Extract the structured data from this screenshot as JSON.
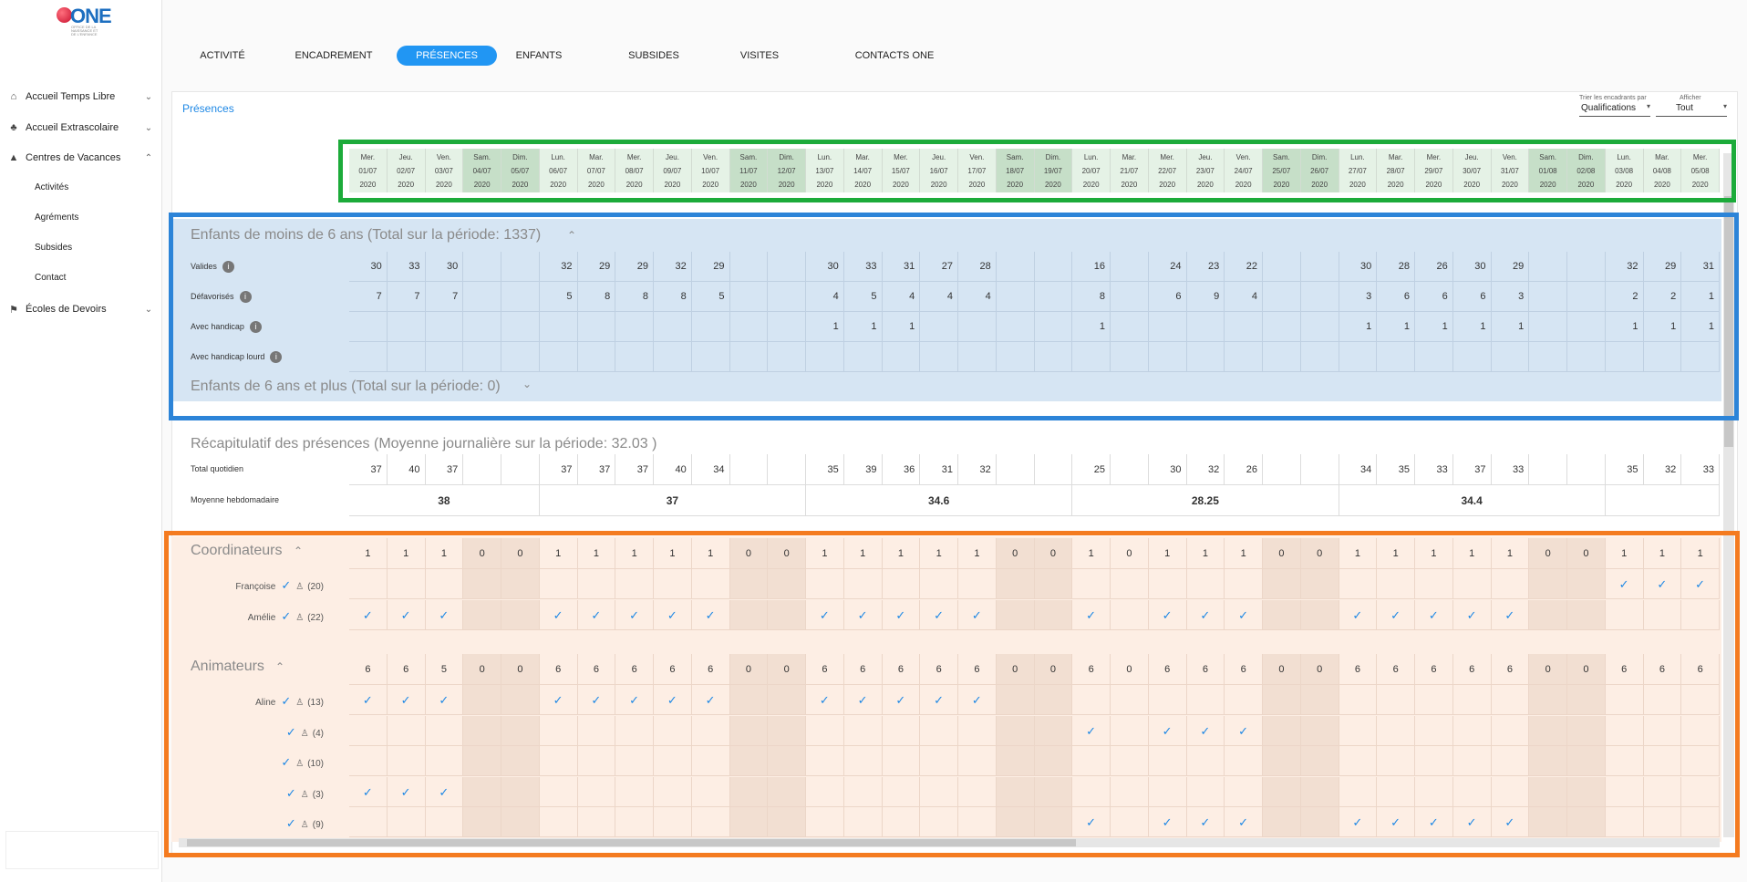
{
  "app": {
    "logo_text": "ONE",
    "logo_tagline": "OFFICE DE LA NAISSANCE ET DE L'ENFANCE"
  },
  "sidebar": {
    "items": [
      {
        "label": "Accueil Temps Libre",
        "icon": "house-icon"
      },
      {
        "label": "Accueil Extrascolaire",
        "icon": "tree-icon"
      },
      {
        "label": "Centres de Vacances",
        "icon": "tent-icon"
      },
      {
        "label": "Écoles de Devoirs",
        "icon": "school-icon"
      }
    ],
    "subitems": [
      "Activités",
      "Agréments",
      "Subsides",
      "Contact"
    ]
  },
  "tabs": [
    "ACTIVITÉ",
    "ENCADREMENT",
    "PRÉSENCES",
    "ENFANTS",
    "SUBSIDES",
    "VISITES",
    "CONTACTS ONE"
  ],
  "active_tab": "PRÉSENCES",
  "card": {
    "title": "Présences",
    "sort_label": "Trier les encadrants par",
    "sort_value": "Qualifications",
    "show_label": "Afficher",
    "show_value": "Tout"
  },
  "dates": {
    "days": [
      "Mer.",
      "Jeu.",
      "Ven.",
      "Sam.",
      "Dim.",
      "Lun.",
      "Mar.",
      "Mer.",
      "Jeu.",
      "Ven.",
      "Sam.",
      "Dim.",
      "Lun.",
      "Mar.",
      "Mer.",
      "Jeu.",
      "Ven.",
      "Sam.",
      "Dim.",
      "Lun.",
      "Mar.",
      "Mer.",
      "Jeu.",
      "Ven.",
      "Sam.",
      "Dim.",
      "Lun.",
      "Mar.",
      "Mer.",
      "Jeu.",
      "Ven.",
      "Sam.",
      "Dim.",
      "Lun.",
      "Mar.",
      "Mer."
    ],
    "dates": [
      "01/07",
      "02/07",
      "03/07",
      "04/07",
      "05/07",
      "06/07",
      "07/07",
      "08/07",
      "09/07",
      "10/07",
      "11/07",
      "12/07",
      "13/07",
      "14/07",
      "15/07",
      "16/07",
      "17/07",
      "18/07",
      "19/07",
      "20/07",
      "21/07",
      "22/07",
      "23/07",
      "24/07",
      "25/07",
      "26/07",
      "27/07",
      "28/07",
      "29/07",
      "30/07",
      "31/07",
      "01/08",
      "02/08",
      "03/08",
      "04/08",
      "05/08"
    ],
    "year": "2020"
  },
  "under6": {
    "title": "Enfants de moins de 6 ans (Total sur la période: 1337)",
    "rows": [
      {
        "label": "Valides",
        "values": [
          "30",
          "33",
          "30",
          "",
          "",
          "32",
          "29",
          "29",
          "32",
          "29",
          "",
          "",
          "30",
          "33",
          "31",
          "27",
          "28",
          "",
          "",
          "16",
          "",
          "24",
          "23",
          "22",
          "",
          "",
          "30",
          "28",
          "26",
          "30",
          "29",
          "",
          "",
          "32",
          "29",
          "31"
        ]
      },
      {
        "label": "Défavorisés",
        "values": [
          "7",
          "7",
          "7",
          "",
          "",
          "5",
          "8",
          "8",
          "8",
          "5",
          "",
          "",
          "4",
          "5",
          "4",
          "4",
          "4",
          "",
          "",
          "8",
          "",
          "6",
          "9",
          "4",
          "",
          "",
          "3",
          "6",
          "6",
          "6",
          "3",
          "",
          "",
          "2",
          "2",
          "1"
        ]
      },
      {
        "label": "Avec handicap",
        "values": [
          "",
          "",
          "",
          "",
          "",
          "",
          "",
          "",
          "",
          "",
          "",
          "",
          "1",
          "1",
          "1",
          "",
          "",
          "",
          "",
          "1",
          "",
          "",
          "",
          "",
          "",
          "",
          "1",
          "1",
          "1",
          "1",
          "1",
          "",
          "",
          "1",
          "1",
          "1"
        ]
      },
      {
        "label": "Avec handicap lourd",
        "values": [
          "",
          "",
          "",
          "",
          "",
          "",
          "",
          "",
          "",
          "",
          "",
          "",
          "",
          "",
          "",
          "",
          "",
          "",
          "",
          "",
          "",
          "",
          "",
          "",
          "",
          "",
          "",
          "",
          "",
          "",
          "",
          "",
          "",
          "",
          "",
          ""
        ]
      }
    ]
  },
  "over6": {
    "title": "Enfants de 6 ans et plus (Total sur la période: 0)"
  },
  "recap": {
    "title": "Récapitulatif des présences (Moyenne journalière sur la période: 32.03 )",
    "total_label": "Total quotidien",
    "total_values": [
      "37",
      "40",
      "37",
      "",
      "",
      "37",
      "37",
      "37",
      "40",
      "34",
      "",
      "",
      "35",
      "39",
      "36",
      "31",
      "32",
      "",
      "",
      "25",
      "",
      "30",
      "32",
      "26",
      "",
      "",
      "34",
      "35",
      "33",
      "37",
      "33",
      "",
      "",
      "35",
      "32",
      "33"
    ],
    "weekly_label": "Moyenne hebdomadaire",
    "weekly_values": [
      "38",
      "37",
      "34.6",
      "28.25",
      "34.4",
      ""
    ]
  },
  "coordinateurs": {
    "title": "Coordinateurs",
    "counts": [
      "1",
      "1",
      "1",
      "0",
      "0",
      "1",
      "1",
      "1",
      "1",
      "1",
      "0",
      "0",
      "1",
      "1",
      "1",
      "1",
      "1",
      "0",
      "0",
      "1",
      "0",
      "1",
      "1",
      "1",
      "0",
      "0",
      "1",
      "1",
      "1",
      "1",
      "1",
      "0",
      "0",
      "1",
      "1",
      "1"
    ],
    "people": [
      {
        "name": "Françoise",
        "count": "(20)",
        "checks": "000000000000000000000000000000000111"
      },
      {
        "name": "Amélie",
        "count": "(22)",
        "checks": "111001111100111110010111001111100000"
      }
    ]
  },
  "animateurs": {
    "title": "Animateurs",
    "counts": [
      "6",
      "6",
      "5",
      "0",
      "0",
      "6",
      "6",
      "6",
      "6",
      "6",
      "0",
      "0",
      "6",
      "6",
      "6",
      "6",
      "6",
      "0",
      "0",
      "6",
      "0",
      "6",
      "6",
      "6",
      "0",
      "0",
      "6",
      "6",
      "6",
      "6",
      "6",
      "0",
      "0",
      "6",
      "6",
      "6"
    ],
    "people": [
      {
        "name": "Aline",
        "count": "(13)",
        "checks": "111001111100111110000000000000000000"
      },
      {
        "name": "",
        "count": "(4)",
        "checks": "000000000000000000010111000000000000"
      },
      {
        "name": "",
        "count": "(10)",
        "checks": "000000000000000000000000000000000000"
      },
      {
        "name": "",
        "count": "(3)",
        "checks": "111000000000000000000000000000000000"
      },
      {
        "name": "",
        "count": "(9)",
        "checks": "000000000000000000010111001111100000"
      }
    ]
  },
  "colors": {
    "accent": "#2196f3",
    "green_highlight": "#1cab3a",
    "blue_highlight": "#2c84d8",
    "orange_highlight": "#f47b20"
  }
}
